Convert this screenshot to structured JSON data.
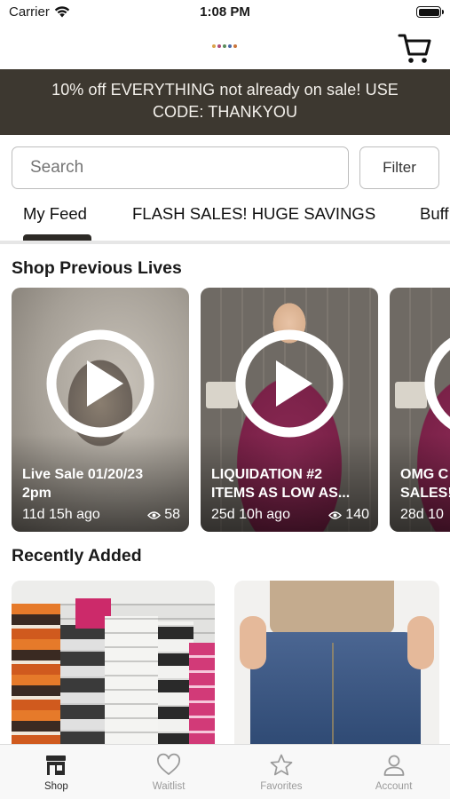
{
  "status_bar": {
    "carrier": "Carrier",
    "time": "1:08 PM"
  },
  "header": {
    "logo_icon": "boutique-logo",
    "cart_icon": "cart-icon"
  },
  "promo": {
    "text": "10% off EVERYTHING not already on sale! USE CODE: THANKYOU"
  },
  "search": {
    "placeholder": "Search",
    "filter_label": "Filter"
  },
  "tabs": [
    {
      "label": "My Feed",
      "active": true
    },
    {
      "label": "FLASH SALES! HUGE SAVINGS",
      "active": false
    },
    {
      "label": "Buff",
      "active": false
    }
  ],
  "sections": {
    "previous_lives_title": "Shop Previous Lives",
    "recently_added_title": "Recently Added"
  },
  "live_cards": [
    {
      "title": "Live Sale 01/20/23\n2pm",
      "age": "11d 15h ago",
      "views": "58"
    },
    {
      "title": "LIQUIDATION #2\nITEMS AS LOW AS...",
      "age": "25d 10h ago",
      "views": "140"
    },
    {
      "title": "OMG C\nSALES!",
      "age": "28d 10",
      "views": ""
    }
  ],
  "tab_bar": [
    {
      "label": "Shop",
      "icon": "storefront-icon",
      "active": true
    },
    {
      "label": "Waitlist",
      "icon": "heart-icon",
      "active": false
    },
    {
      "label": "Favorites",
      "icon": "star-icon",
      "active": false
    },
    {
      "label": "Account",
      "icon": "person-icon",
      "active": false
    }
  ],
  "colors": {
    "promo_bg": "#3d3830",
    "promo_text": "#f4f1ec",
    "active_indicator": "#2d2a26",
    "tab_inactive": "#9a9a9a"
  }
}
